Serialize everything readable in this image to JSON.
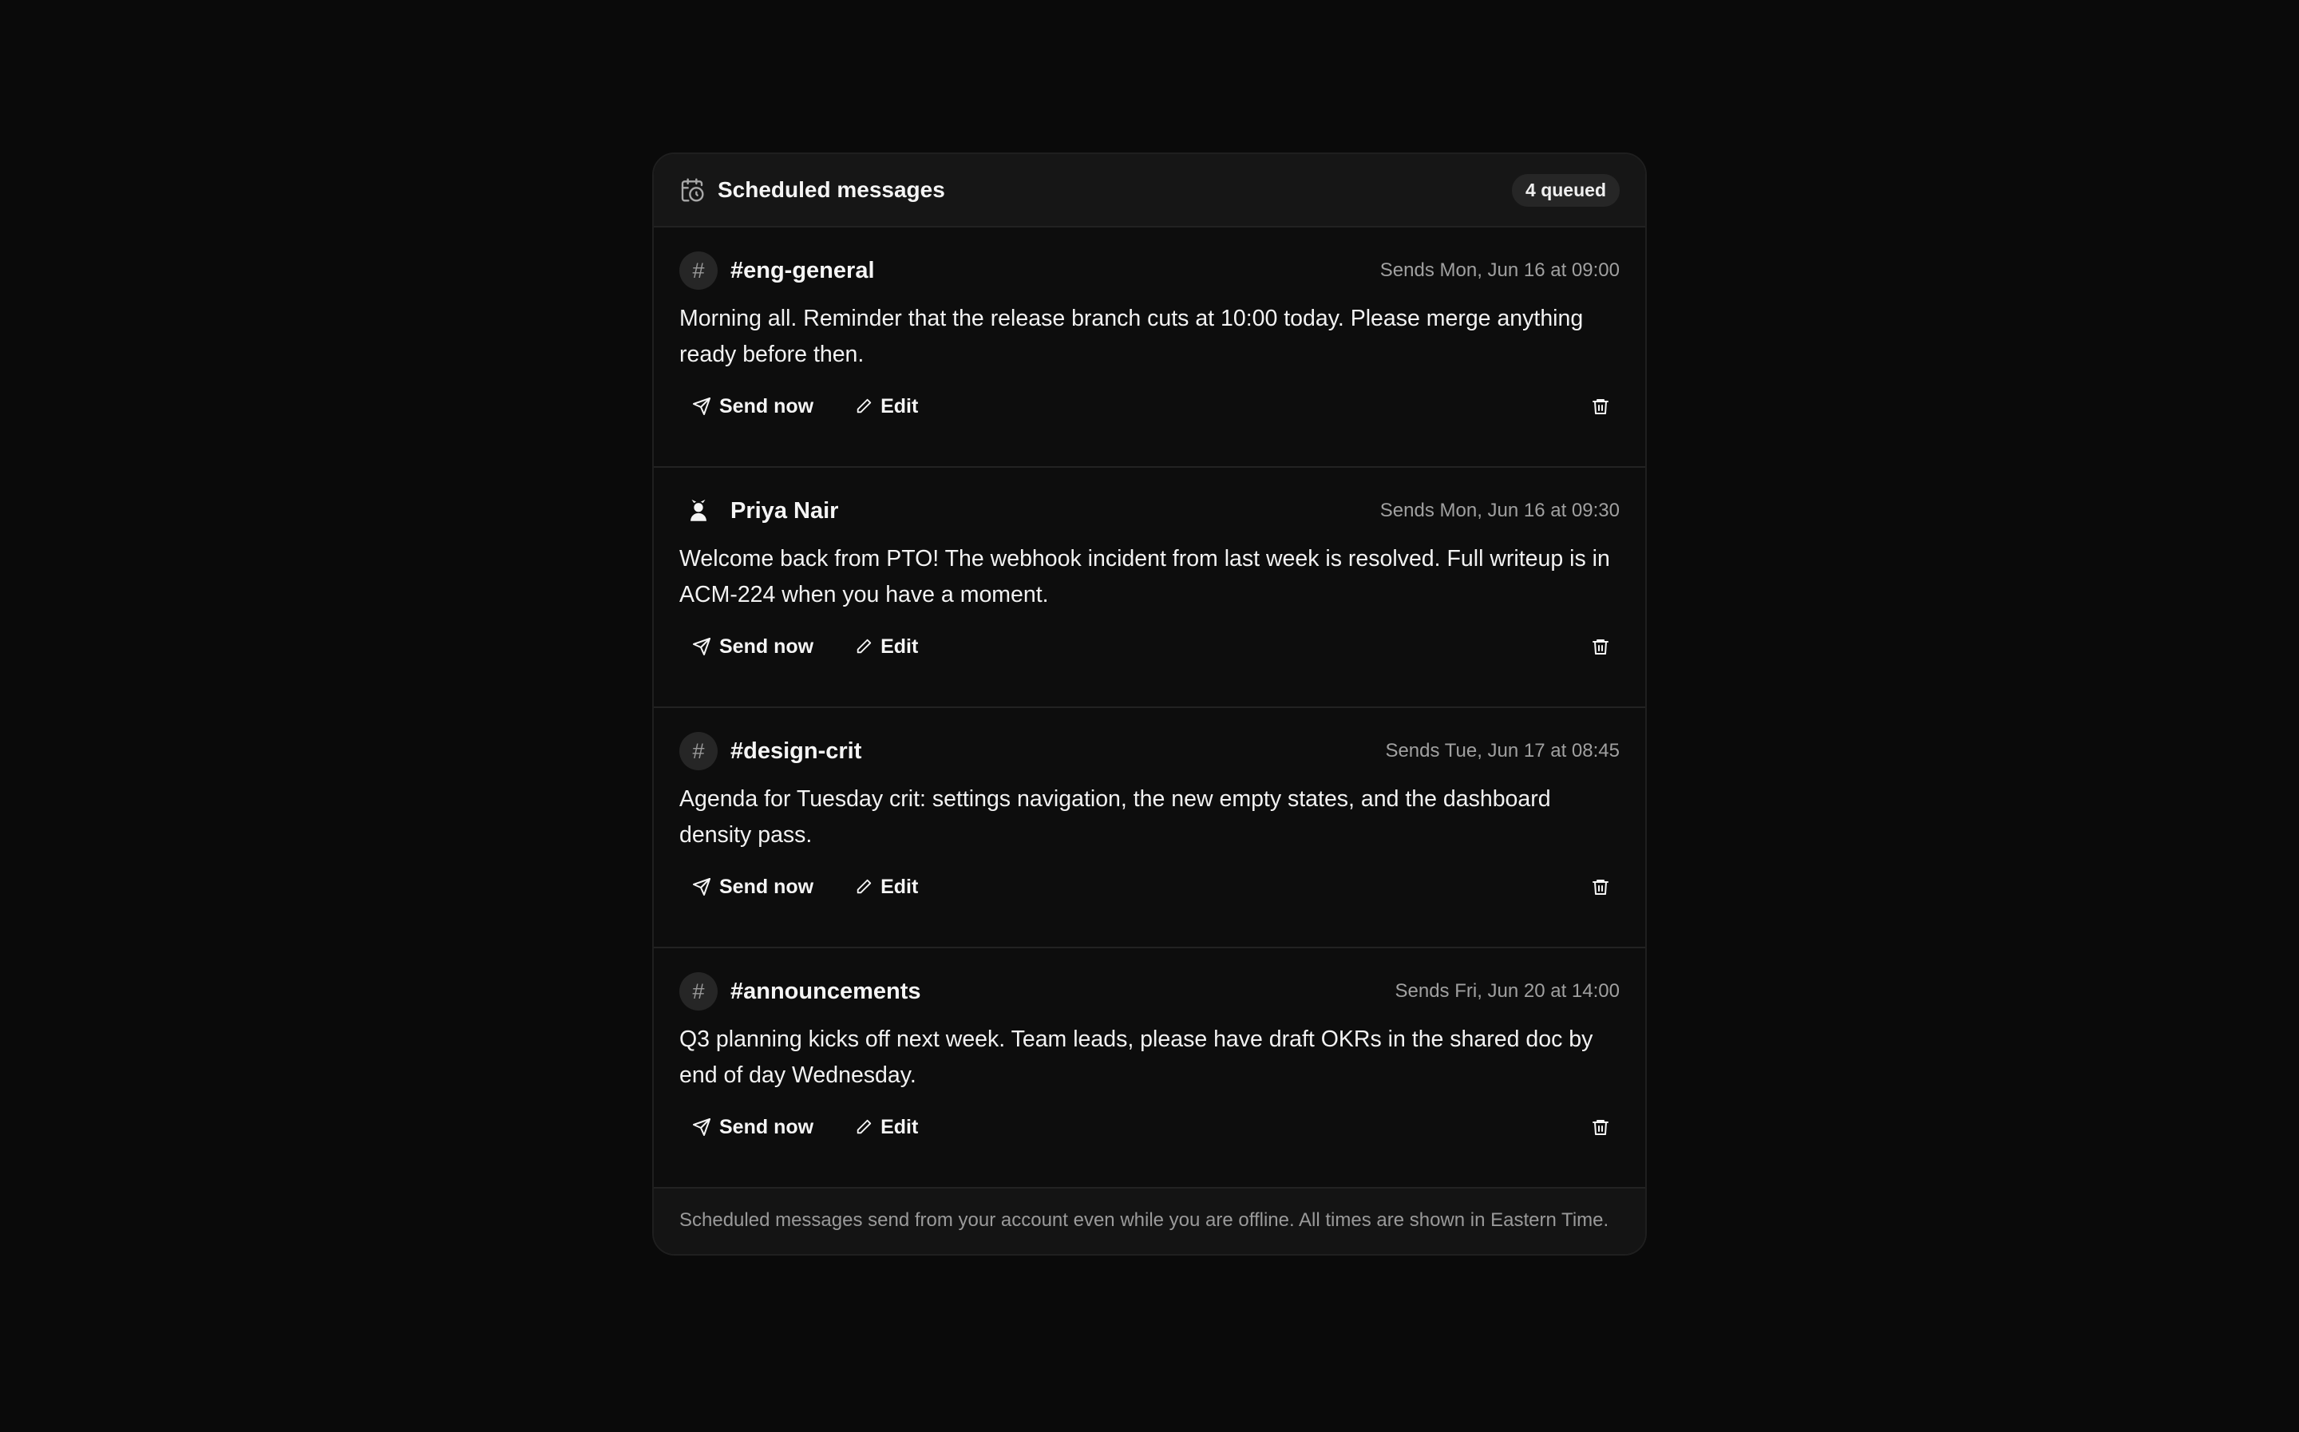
{
  "header": {
    "title": "Scheduled messages",
    "badge": "4 queued",
    "icon": "calendar-clock-icon"
  },
  "messages": [
    {
      "kind": "channel",
      "target": "#eng-general",
      "when": "Sends Mon, Jun 16 at 09:00",
      "body": "Morning all. Reminder that the release branch cuts at 10:00 today. Please merge anything ready before then."
    },
    {
      "kind": "user",
      "target": "Priya Nair",
      "when": "Sends Mon, Jun 16 at 09:30",
      "body": "Welcome back from PTO! The webhook incident from last week is resolved. Full writeup is in ACM-224 when you have a moment."
    },
    {
      "kind": "channel",
      "target": "#design-crit",
      "when": "Sends Tue, Jun 17 at 08:45",
      "body": "Agenda for Tuesday crit: settings navigation, the new empty states, and the dashboard density pass."
    },
    {
      "kind": "channel",
      "target": "#announcements",
      "when": "Sends Fri, Jun 20 at 14:00",
      "body": "Q3 planning kicks off next week. Team leads, please have draft OKRs in the shared doc by end of day Wednesday."
    }
  ],
  "actions": {
    "send_now": "Send now",
    "edit": "Edit"
  },
  "footer": {
    "note": "Scheduled messages send from your account even while you are offline. All times are shown in Eastern Time."
  },
  "colors": {
    "background": "#0a0a0a",
    "panel": "#0d0d0d",
    "header": "#161616",
    "badge": "#262626"
  }
}
